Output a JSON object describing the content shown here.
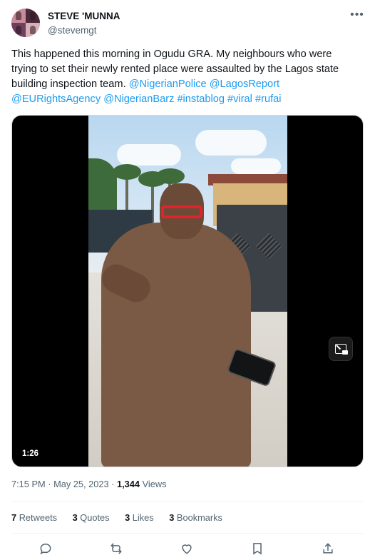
{
  "author": {
    "display_name": "STEVE 'MUNNA",
    "handle": "@stevemgt",
    "more_icon": "ellipsis-icon"
  },
  "tweet": {
    "text_plain": "This happened this morning in Ogudu GRA. My neighbours who were trying to set their newly rented place were assaulted by the Lagos state building inspection team.",
    "mentions": [
      "@NigerianPolice",
      "@LagosReport",
      "@EURightsAgency",
      "@NigerianBarz"
    ],
    "hashtags": [
      "#instablog",
      "#viral",
      "#rufai"
    ]
  },
  "media": {
    "duration": "1:26",
    "pip_icon": "picture-in-picture-icon"
  },
  "meta": {
    "time": "7:15 PM",
    "separator": "·",
    "date": "May 25, 2023",
    "views_count": "1,344",
    "views_label": "Views"
  },
  "stats": [
    {
      "count": "7",
      "label": "Retweets"
    },
    {
      "count": "3",
      "label": "Quotes"
    },
    {
      "count": "3",
      "label": "Likes"
    },
    {
      "count": "3",
      "label": "Bookmarks"
    }
  ],
  "actions": [
    {
      "icon": "reply-icon"
    },
    {
      "icon": "retweet-icon"
    },
    {
      "icon": "like-icon"
    },
    {
      "icon": "bookmark-icon"
    },
    {
      "icon": "share-icon"
    }
  ],
  "colors": {
    "link": "#1d9bf0",
    "secondary_text": "#536471",
    "primary_text": "#0f1419"
  }
}
